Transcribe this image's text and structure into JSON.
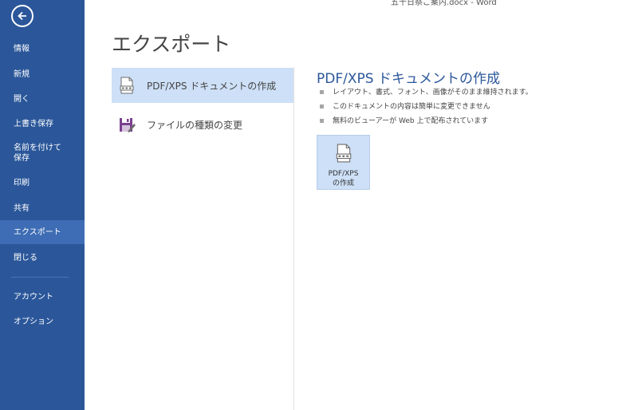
{
  "window": {
    "title": "五十日祭ご案内.docx - Word"
  },
  "sidebar": {
    "items": [
      {
        "label": "情報"
      },
      {
        "label": "新規"
      },
      {
        "label": "開く"
      },
      {
        "label": "上書き保存"
      },
      {
        "label": "名前を付けて\n保存"
      },
      {
        "label": "印刷"
      },
      {
        "label": "共有"
      },
      {
        "label": "エクスポート"
      },
      {
        "label": "閉じる"
      },
      {
        "label": "アカウント"
      },
      {
        "label": "オプション"
      }
    ]
  },
  "main": {
    "title": "エクスポート",
    "options": [
      {
        "label": "PDF/XPS ドキュメントの作成",
        "icon": "pdf-document-icon"
      },
      {
        "label": "ファイルの種類の変更",
        "icon": "save-edit-icon"
      }
    ],
    "detail": {
      "title": "PDF/XPS ドキュメントの作成",
      "bullets": [
        "レイアウト、書式、フォント、画像がそのまま維持されます。",
        "このドキュメントの内容は簡単に変更できません",
        "無料のビューアーが Web 上で配布されています"
      ],
      "create_button": {
        "line1": "PDF/XPS",
        "line2": "の作成"
      }
    }
  },
  "colors": {
    "sidebar": "#2b579a",
    "sidebar_active": "#3e6db5",
    "selected": "#cde0f7",
    "accent": "#2b579a"
  }
}
